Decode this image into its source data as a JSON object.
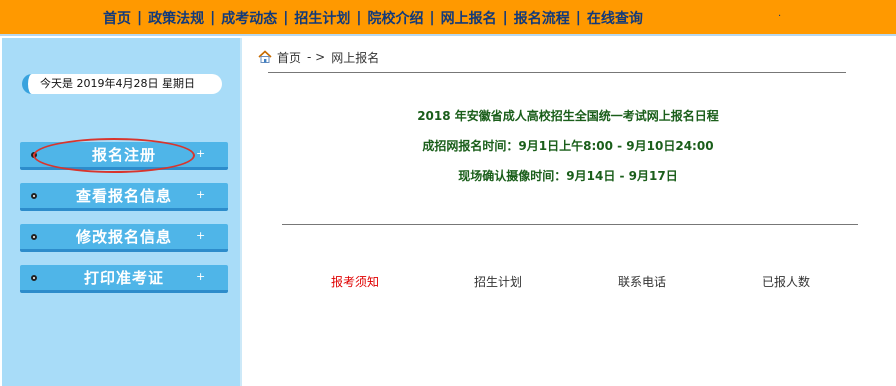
{
  "nav": {
    "items": [
      "首页",
      "政策法规",
      "成考动态",
      "招生计划",
      "院校介绍",
      "网上报名",
      "报名流程",
      "在线查询"
    ],
    "separator": "|",
    "trailing_dot": "·"
  },
  "sidebar": {
    "date_text": "今天是 2019年4月28日 星期日",
    "menu": [
      {
        "label": "报名注册",
        "plus": "+"
      },
      {
        "label": "查看报名信息",
        "plus": "+"
      },
      {
        "label": "修改报名信息",
        "plus": "+"
      },
      {
        "label": "打印准考证",
        "plus": "+"
      }
    ]
  },
  "breadcrumb": {
    "home": "首页",
    "arrow": "- >",
    "current": "网上报名"
  },
  "schedule": {
    "title": "2018 年安徽省成人高校招生全国统一考试网上报名日程",
    "online_time": "成招网报名时间：9月1日上午8:00 - 9月10日24:00",
    "onsite_time": "现场确认摄像时间：9月14日 - 9月17日"
  },
  "tabs": [
    {
      "label": "报考须知",
      "active": true
    },
    {
      "label": "招生计划",
      "active": false
    },
    {
      "label": "联系电话",
      "active": false
    },
    {
      "label": "已报人数",
      "active": false
    }
  ],
  "colors": {
    "nav_bg": "#ff9900",
    "nav_text": "#123a7a",
    "sidebar_bg": "#a8dcf8",
    "menu_btn": "#4fb5e8",
    "schedule_text": "#1a5e1a",
    "active_tab": "#e00000",
    "highlight_circle": "#d8352d"
  }
}
